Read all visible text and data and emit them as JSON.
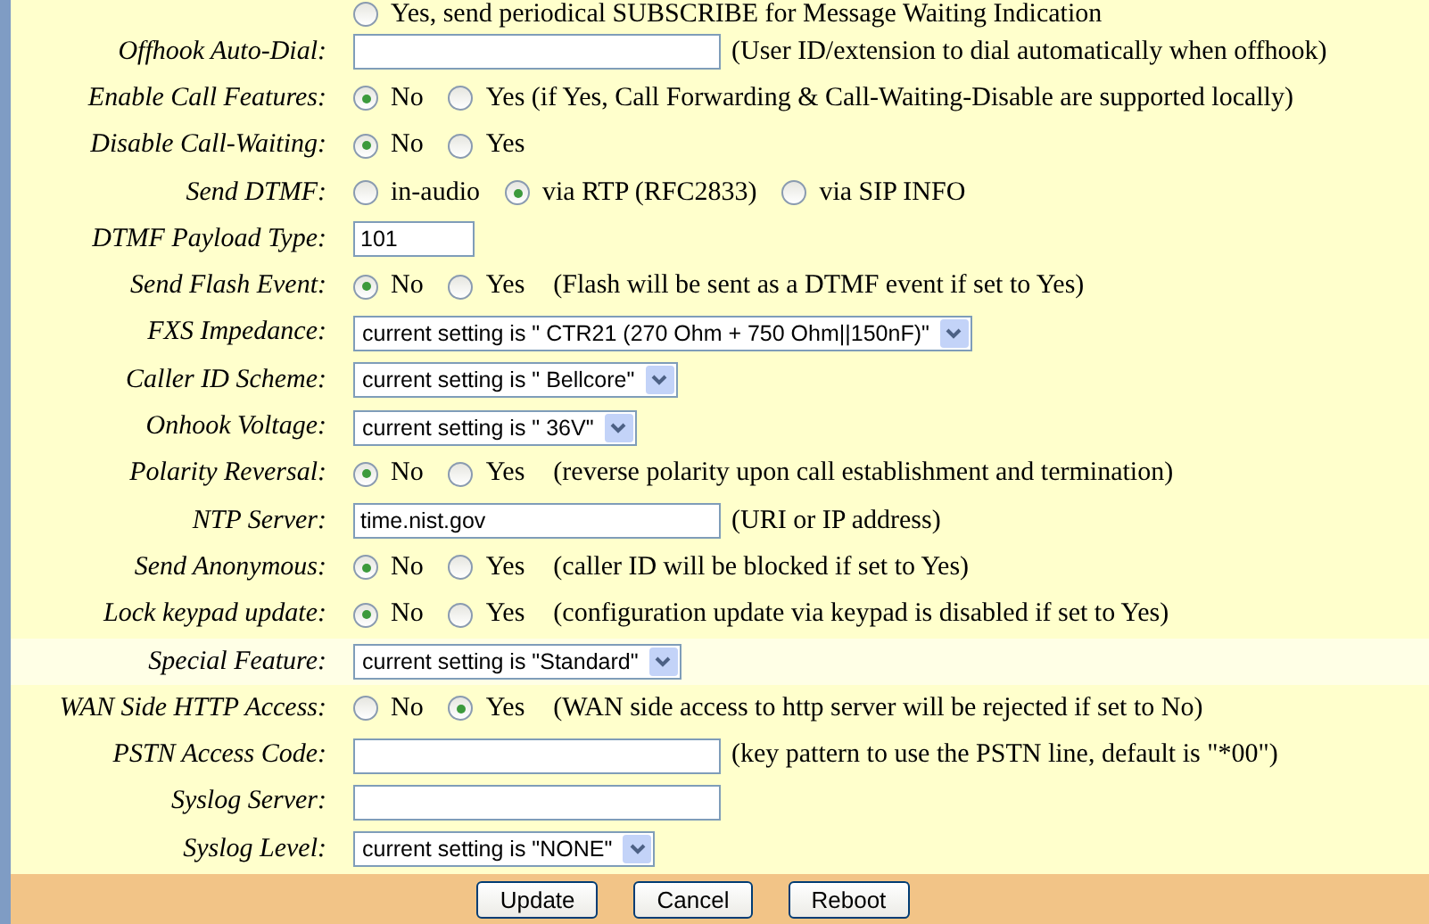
{
  "rows": [
    {
      "kind": "radio",
      "options": [
        {
          "label": "Yes, send periodical SUBSCRIBE for Message Waiting Indication",
          "selected": false
        }
      ]
    },
    {
      "kind": "text",
      "label": "Offhook Auto-Dial:",
      "value": "",
      "note": "(User ID/extension to dial automatically when offhook)"
    },
    {
      "kind": "radio",
      "label": "Enable Call Features:",
      "options": [
        {
          "label": "No",
          "selected": true
        },
        {
          "label": "Yes (if Yes, Call Forwarding & Call-Waiting-Disable are supported locally)",
          "selected": false
        }
      ]
    },
    {
      "kind": "radio",
      "label": "Disable Call-Waiting:",
      "options": [
        {
          "label": "No",
          "selected": true
        },
        {
          "label": "Yes",
          "selected": false
        }
      ]
    },
    {
      "kind": "radio",
      "label": "Send DTMF:",
      "options": [
        {
          "label": "in-audio",
          "selected": false
        },
        {
          "label": "via RTP (RFC2833)",
          "selected": true
        },
        {
          "label": "via SIP INFO",
          "selected": false
        }
      ]
    },
    {
      "kind": "text",
      "label": "DTMF Payload Type:",
      "value": "101"
    },
    {
      "kind": "radio",
      "label": "Send Flash Event:",
      "options": [
        {
          "label": "No",
          "selected": true
        },
        {
          "label": "Yes",
          "selected": false
        }
      ],
      "note": "(Flash will be sent as a DTMF event if set to Yes)"
    },
    {
      "kind": "select",
      "label": "FXS Impedance:",
      "value": "current setting is \" CTR21 (270 Ohm + 750 Ohm||150nF)\""
    },
    {
      "kind": "select",
      "label": "Caller ID Scheme:",
      "value": "current setting is \" Bellcore\""
    },
    {
      "kind": "select",
      "label": "Onhook Voltage:",
      "value": "current setting is \" 36V\""
    },
    {
      "kind": "radio",
      "label": "Polarity Reversal:",
      "options": [
        {
          "label": "No",
          "selected": true
        },
        {
          "label": "Yes",
          "selected": false
        }
      ],
      "note": "(reverse polarity upon call establishment and termination)"
    },
    {
      "kind": "text",
      "label": "NTP Server:",
      "value": "time.nist.gov",
      "note": "(URI or IP address)"
    },
    {
      "kind": "radio",
      "label": "Send Anonymous:",
      "options": [
        {
          "label": "No",
          "selected": true
        },
        {
          "label": "Yes",
          "selected": false
        }
      ],
      "note": "(caller ID will be blocked if set to Yes)"
    },
    {
      "kind": "radio",
      "label": "Lock keypad update:",
      "options": [
        {
          "label": "No",
          "selected": true
        },
        {
          "label": "Yes",
          "selected": false
        }
      ],
      "note": "(configuration update via keypad is disabled if set to Yes)"
    },
    {
      "kind": "select",
      "label": "Special Feature:",
      "value": "current setting is \"Standard\"",
      "highlighted": true
    },
    {
      "kind": "radio",
      "label": "WAN Side HTTP Access:",
      "options": [
        {
          "label": "No",
          "selected": false
        },
        {
          "label": "Yes",
          "selected": true
        }
      ],
      "note": "(WAN side access to http server will be rejected if set to No)"
    },
    {
      "kind": "text",
      "label": "PSTN Access Code:",
      "value": "",
      "note": "(key pattern to use the PSTN line, default is \"*00\")"
    },
    {
      "kind": "text",
      "label": "Syslog Server:",
      "value": ""
    },
    {
      "kind": "select",
      "label": "Syslog Level:",
      "value": "current setting is \"NONE\""
    }
  ],
  "buttons": [
    "Update",
    "Cancel",
    "Reboot"
  ]
}
